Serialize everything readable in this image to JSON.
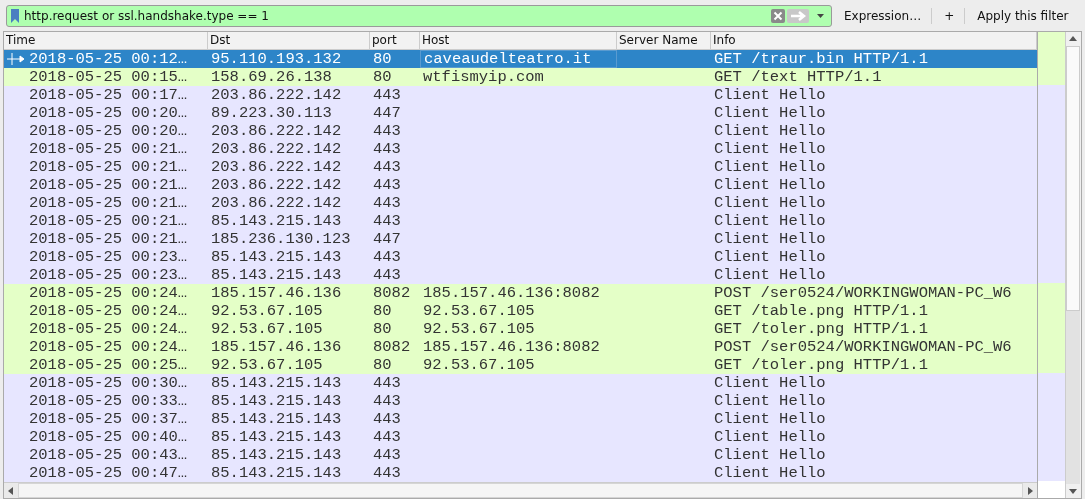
{
  "filter_bar": {
    "value": "http.request or ssl.handshake.type == 1",
    "buttons": [
      "Expression…",
      "+",
      "Apply this filter"
    ]
  },
  "table": {
    "columns": [
      "Time",
      "Dst",
      "port",
      "Host",
      "Server Name",
      "Info"
    ],
    "rows": [
      {
        "selected": true,
        "color": "#e4ffc7",
        "cells": [
          "2018-05-25 00:12…",
          "95.110.193.132",
          "80",
          "caveaudelteatro.it",
          "",
          "GET /traur.bin HTTP/1.1"
        ]
      },
      {
        "selected": false,
        "color": "#e4ffc7",
        "cells": [
          "2018-05-25 00:15…",
          "158.69.26.138",
          "80",
          "wtfismyip.com",
          "",
          "GET /text HTTP/1.1"
        ]
      },
      {
        "selected": false,
        "color": "#e7e6ff",
        "cells": [
          "2018-05-25 00:17…",
          "203.86.222.142",
          "443",
          "",
          "",
          "Client Hello"
        ]
      },
      {
        "selected": false,
        "color": "#e7e6ff",
        "cells": [
          "2018-05-25 00:20…",
          "89.223.30.113",
          "447",
          "",
          "",
          "Client Hello"
        ]
      },
      {
        "selected": false,
        "color": "#e7e6ff",
        "cells": [
          "2018-05-25 00:20…",
          "203.86.222.142",
          "443",
          "",
          "",
          "Client Hello"
        ]
      },
      {
        "selected": false,
        "color": "#e7e6ff",
        "cells": [
          "2018-05-25 00:21…",
          "203.86.222.142",
          "443",
          "",
          "",
          "Client Hello"
        ]
      },
      {
        "selected": false,
        "color": "#e7e6ff",
        "cells": [
          "2018-05-25 00:21…",
          "203.86.222.142",
          "443",
          "",
          "",
          "Client Hello"
        ]
      },
      {
        "selected": false,
        "color": "#e7e6ff",
        "cells": [
          "2018-05-25 00:21…",
          "203.86.222.142",
          "443",
          "",
          "",
          "Client Hello"
        ]
      },
      {
        "selected": false,
        "color": "#e7e6ff",
        "cells": [
          "2018-05-25 00:21…",
          "203.86.222.142",
          "443",
          "",
          "",
          "Client Hello"
        ]
      },
      {
        "selected": false,
        "color": "#e7e6ff",
        "cells": [
          "2018-05-25 00:21…",
          "85.143.215.143",
          "443",
          "",
          "",
          "Client Hello"
        ]
      },
      {
        "selected": false,
        "color": "#e7e6ff",
        "cells": [
          "2018-05-25 00:21…",
          "185.236.130.123",
          "447",
          "",
          "",
          "Client Hello"
        ]
      },
      {
        "selected": false,
        "color": "#e7e6ff",
        "cells": [
          "2018-05-25 00:23…",
          "85.143.215.143",
          "443",
          "",
          "",
          "Client Hello"
        ]
      },
      {
        "selected": false,
        "color": "#e7e6ff",
        "cells": [
          "2018-05-25 00:23…",
          "85.143.215.143",
          "443",
          "",
          "",
          "Client Hello"
        ]
      },
      {
        "selected": false,
        "color": "#e4ffc7",
        "cells": [
          "2018-05-25 00:24…",
          "185.157.46.136",
          "8082",
          "185.157.46.136:8082",
          "",
          "POST /ser0524/WORKINGWOMAN-PC_W6"
        ]
      },
      {
        "selected": false,
        "color": "#e4ffc7",
        "cells": [
          "2018-05-25 00:24…",
          "92.53.67.105",
          "80",
          "92.53.67.105",
          "",
          "GET /table.png HTTP/1.1"
        ]
      },
      {
        "selected": false,
        "color": "#e4ffc7",
        "cells": [
          "2018-05-25 00:24…",
          "92.53.67.105",
          "80",
          "92.53.67.105",
          "",
          "GET /toler.png HTTP/1.1"
        ]
      },
      {
        "selected": false,
        "color": "#e4ffc7",
        "cells": [
          "2018-05-25 00:24…",
          "185.157.46.136",
          "8082",
          "185.157.46.136:8082",
          "",
          "POST /ser0524/WORKINGWOMAN-PC_W6"
        ]
      },
      {
        "selected": false,
        "color": "#e4ffc7",
        "cells": [
          "2018-05-25 00:25…",
          "92.53.67.105",
          "80",
          "92.53.67.105",
          "",
          "GET /toler.png HTTP/1.1"
        ]
      },
      {
        "selected": false,
        "color": "#e7e6ff",
        "cells": [
          "2018-05-25 00:30…",
          "85.143.215.143",
          "443",
          "",
          "",
          "Client Hello"
        ]
      },
      {
        "selected": false,
        "color": "#e7e6ff",
        "cells": [
          "2018-05-25 00:33…",
          "85.143.215.143",
          "443",
          "",
          "",
          "Client Hello"
        ]
      },
      {
        "selected": false,
        "color": "#e7e6ff",
        "cells": [
          "2018-05-25 00:37…",
          "85.143.215.143",
          "443",
          "",
          "",
          "Client Hello"
        ]
      },
      {
        "selected": false,
        "color": "#e7e6ff",
        "cells": [
          "2018-05-25 00:40…",
          "85.143.215.143",
          "443",
          "",
          "",
          "Client Hello"
        ]
      },
      {
        "selected": false,
        "color": "#e7e6ff",
        "cells": [
          "2018-05-25 00:43…",
          "85.143.215.143",
          "443",
          "",
          "",
          "Client Hello"
        ]
      },
      {
        "selected": false,
        "color": "#e7e6ff",
        "cells": [
          "2018-05-25 00:47…",
          "85.143.215.143",
          "443",
          "",
          "",
          "Client Hello"
        ]
      }
    ]
  }
}
